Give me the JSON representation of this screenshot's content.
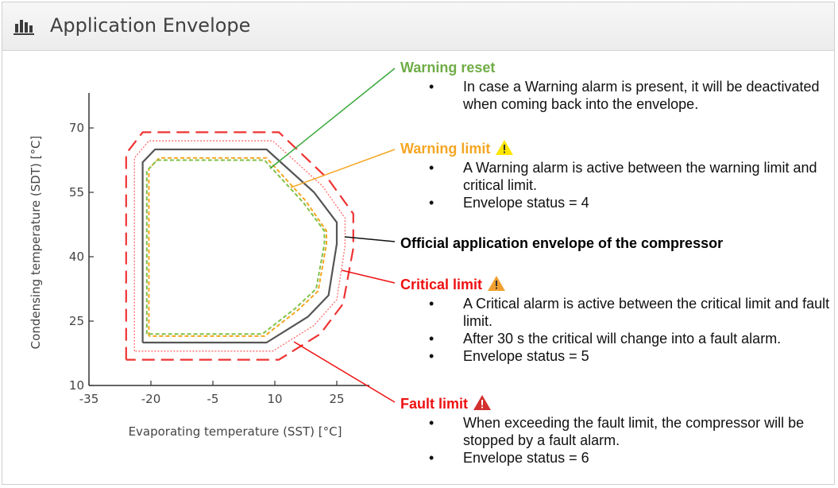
{
  "panel": {
    "title": "Application Envelope",
    "icon": "bar-chart-icon"
  },
  "chart_data": {
    "type": "line",
    "xlabel": "Evaporating temperature (SST) [°C]",
    "ylabel": "Condensing temperature (SDT) [°C]",
    "xlim": [
      -35,
      30
    ],
    "ylim": [
      10,
      78
    ],
    "xticks": [
      -35,
      -20,
      -5,
      10,
      25
    ],
    "yticks": [
      10,
      25,
      40,
      55,
      70
    ],
    "xtick_labels": [
      "-35",
      "-20",
      "-5",
      "10",
      "25"
    ],
    "ytick_labels": [
      "10",
      "25",
      "40",
      "55",
      "70"
    ],
    "grid": false,
    "series": [
      {
        "name": "Official application envelope of the compressor",
        "color": "#555555",
        "style": "solid",
        "points": [
          [
            -22,
            20
          ],
          [
            -22,
            62
          ],
          [
            -19,
            65
          ],
          [
            8,
            65
          ],
          [
            19.5,
            55
          ],
          [
            25,
            48
          ],
          [
            25,
            43
          ],
          [
            23,
            31
          ],
          [
            18,
            26
          ],
          [
            8,
            20
          ],
          [
            -22,
            20
          ]
        ]
      },
      {
        "name": "Warning limit",
        "color": "#f5a623",
        "style": "dashed",
        "points": [
          [
            -20.5,
            21.5
          ],
          [
            -20.5,
            60.5
          ],
          [
            -18,
            63
          ],
          [
            8,
            63
          ],
          [
            17.5,
            53
          ],
          [
            22.5,
            46
          ],
          [
            22.5,
            43
          ],
          [
            20.5,
            32
          ],
          [
            15.5,
            27.5
          ],
          [
            7.5,
            21.5
          ],
          [
            -20.5,
            21.5
          ]
        ]
      },
      {
        "name": "Warning reset",
        "color": "#7fc24a",
        "style": "dashed",
        "points": [
          [
            -21,
            22
          ],
          [
            -21,
            60
          ],
          [
            -18.5,
            62.5
          ],
          [
            7.5,
            62.5
          ],
          [
            17,
            52.5
          ],
          [
            22,
            46
          ],
          [
            22,
            43
          ],
          [
            20,
            32.5
          ],
          [
            15,
            28
          ],
          [
            7,
            22
          ],
          [
            -21,
            22
          ]
        ]
      },
      {
        "name": "Critical limit",
        "color": "#ff6b6b",
        "style": "dotted",
        "points": [
          [
            -24,
            18
          ],
          [
            -24,
            63
          ],
          [
            -20.5,
            67
          ],
          [
            9.5,
            67
          ],
          [
            21.5,
            56.5
          ],
          [
            27,
            49
          ],
          [
            27,
            42.5
          ],
          [
            25,
            30
          ],
          [
            19.5,
            24
          ],
          [
            9.5,
            18
          ],
          [
            -24,
            18
          ]
        ]
      },
      {
        "name": "Fault limit",
        "color": "#ee3333",
        "style": "dashed",
        "points": [
          [
            -26,
            16
          ],
          [
            -26,
            64
          ],
          [
            -22,
            69
          ],
          [
            11,
            69
          ],
          [
            23,
            58
          ],
          [
            29,
            50
          ],
          [
            29,
            42
          ],
          [
            26.5,
            29
          ],
          [
            21,
            22
          ],
          [
            11,
            16
          ],
          [
            -26,
            16
          ]
        ]
      }
    ]
  },
  "callouts": {
    "warning_reset": {
      "title": "Warning reset",
      "color": "#70ad47",
      "bullets": [
        "In case a Warning alarm is present, it will be deactivated when coming back into the envelope."
      ]
    },
    "warning_limit": {
      "title": "Warning limit",
      "color": "#f5a623",
      "icon": "warning-triangle-yellow-icon",
      "bullets": [
        "A Warning alarm is active between the warning limit and critical limit.",
        "Envelope status = 4"
      ]
    },
    "official": {
      "title": "Official application envelope of the compressor",
      "color": "#000000"
    },
    "critical_limit": {
      "title": "Critical limit",
      "color": "#ee1111",
      "icon": "warning-triangle-orange-icon",
      "bullets": [
        "A Critical alarm is active between the critical limit and fault limit.",
        "After 30 s the critical will change into a fault alarm.",
        "Envelope status = 5"
      ]
    },
    "fault_limit": {
      "title": "Fault limit",
      "color": "#ee1111",
      "icon": "warning-triangle-red-icon",
      "bullets": [
        "When exceeding the fault limit, the compressor will be stopped by a fault alarm.",
        "Envelope status = 6"
      ]
    }
  }
}
